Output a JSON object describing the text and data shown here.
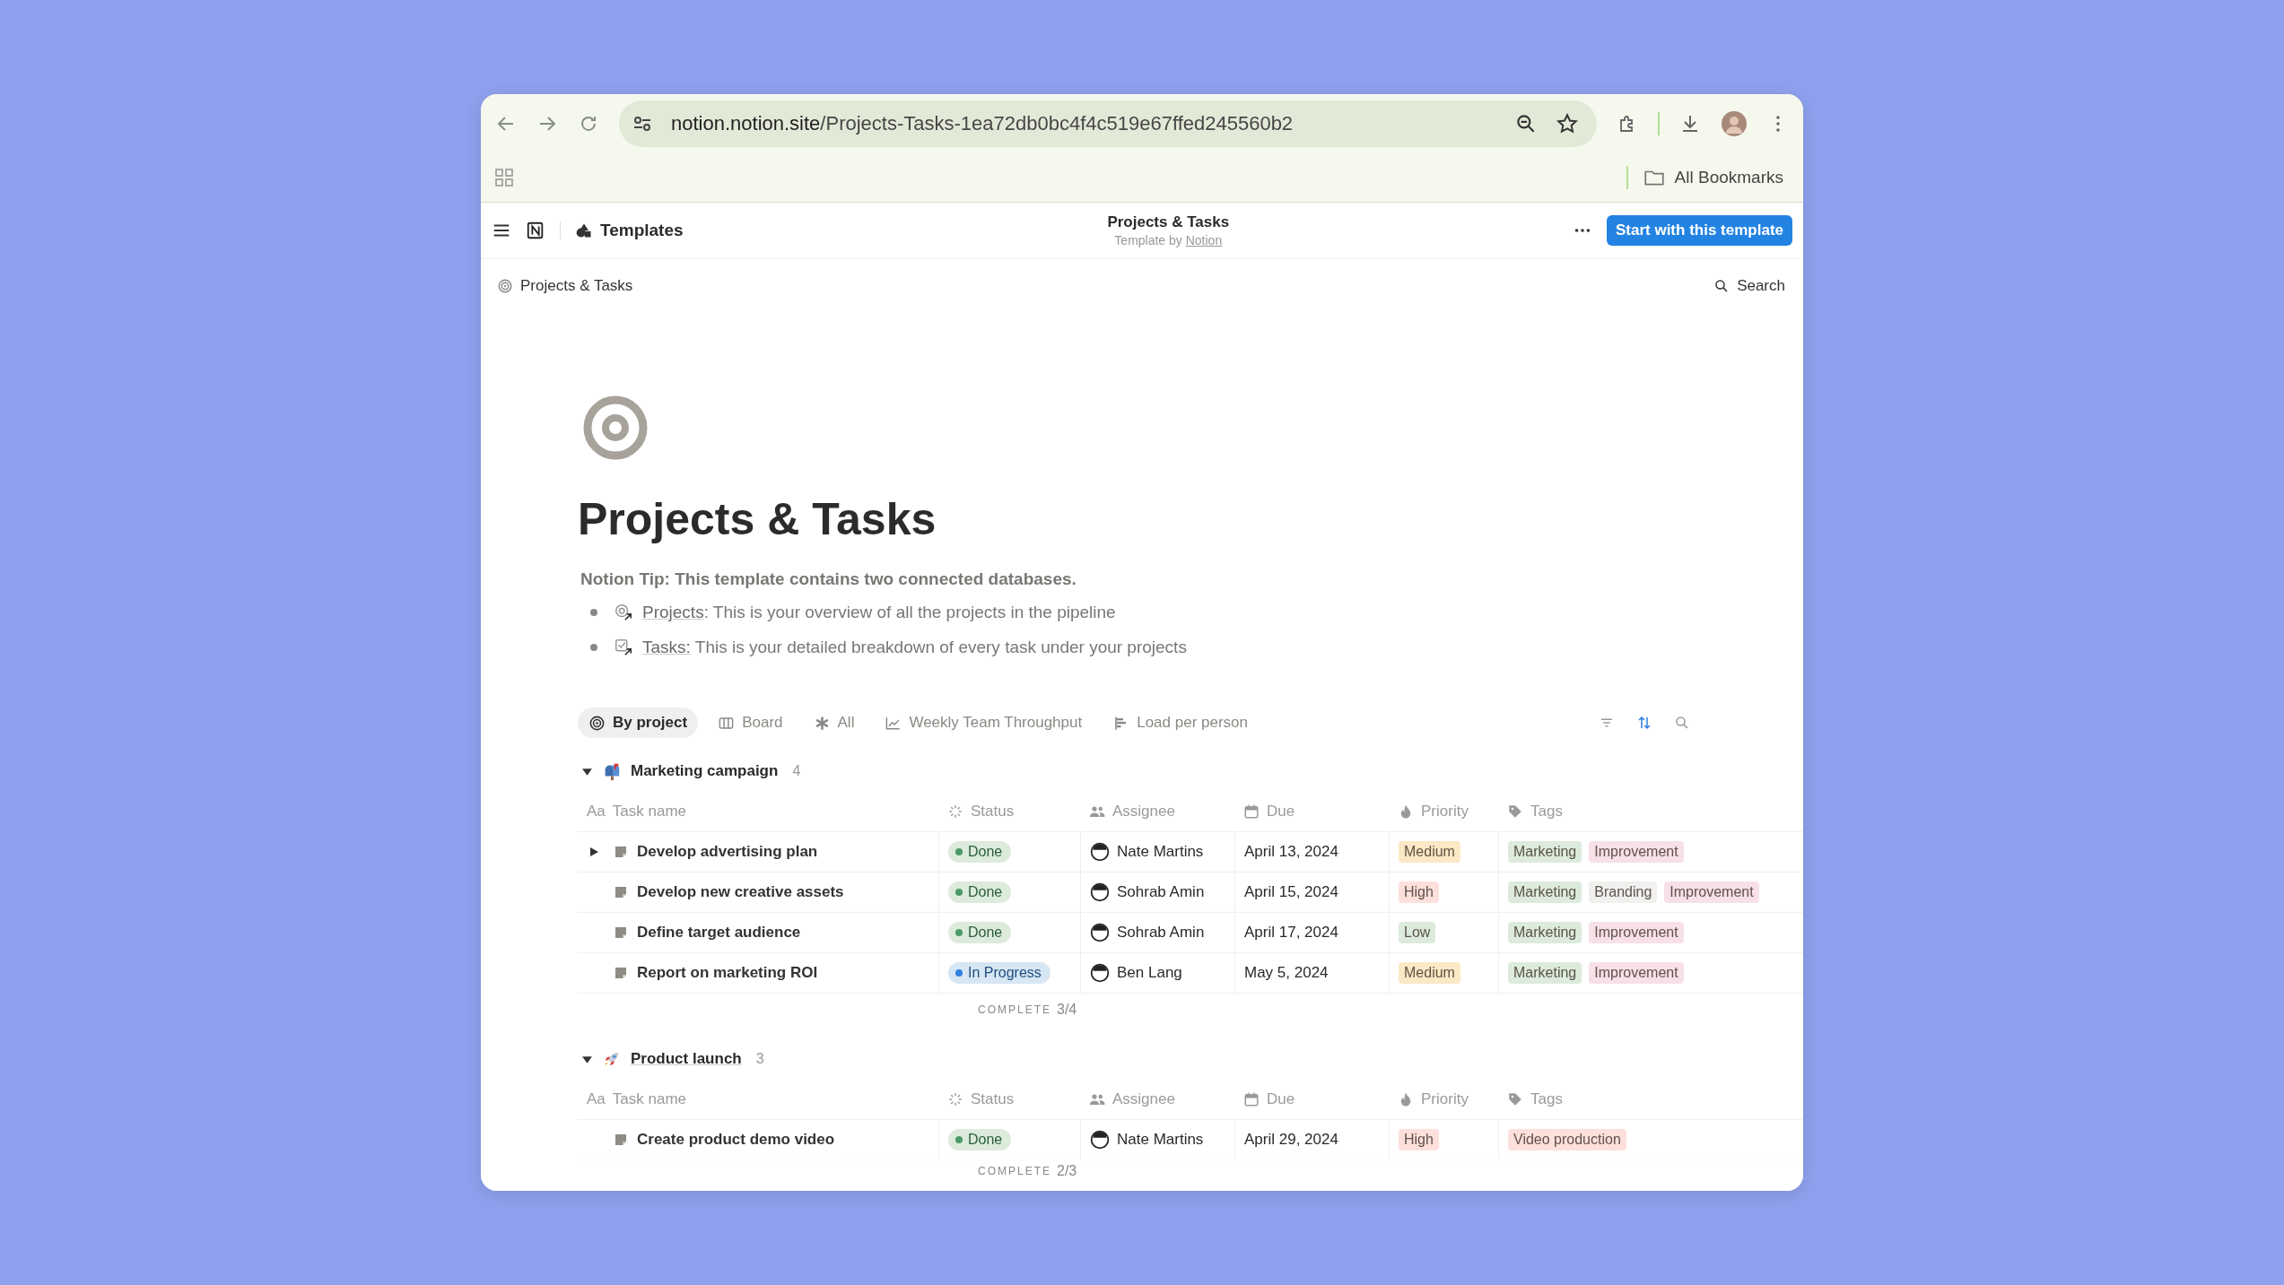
{
  "browser": {
    "url_host": "notion.notion.site",
    "url_path": "/Projects-Tasks-1ea72db0bc4f4c519e67ffed245560b2",
    "bookmarks": "All Bookmarks"
  },
  "topbar": {
    "workspace": "Templates",
    "title": "Projects & Tasks",
    "byline": "Template by",
    "author": "Notion",
    "button": "Start with this template"
  },
  "breadcrumb": "Projects & Tasks",
  "search": "Search",
  "page": {
    "title": "Projects & Tasks",
    "tip": "Notion Tip: This template contains two connected databases.",
    "bullets": [
      {
        "link": "Projects",
        "text": ": This is your overview of all the projects in the pipeline"
      },
      {
        "link": "Tasks:",
        "text": " This is your detailed breakdown of every task under your projects"
      }
    ]
  },
  "views": [
    {
      "label": "By project",
      "selected": true
    },
    {
      "label": "Board",
      "selected": false
    },
    {
      "label": "All",
      "selected": false
    },
    {
      "label": "Weekly Team Throughput",
      "selected": false
    },
    {
      "label": "Load per person",
      "selected": false
    }
  ],
  "groups": [
    {
      "name": "Marketing campaign",
      "count": "4",
      "expanded": true,
      "footer_label": "COMPLETE",
      "footer_value": "3/4",
      "columns": [
        {
          "label": "Task name",
          "glyph": "Aa"
        },
        {
          "label": "Status"
        },
        {
          "label": "Assignee"
        },
        {
          "label": "Due"
        },
        {
          "label": "Priority"
        },
        {
          "label": "Tags"
        }
      ],
      "rows": [
        {
          "name": "Develop advertising plan",
          "expandable": true,
          "status": {
            "label": "Done",
            "kind": "done"
          },
          "assignee": "Nate Martins",
          "due": "April 13, 2024",
          "priority": {
            "label": "Medium",
            "color": "#fbe8c4"
          },
          "tags": [
            {
              "label": "Marketing",
              "color": "#dcebdc"
            },
            {
              "label": "Improvement",
              "color": "#f7e0e8"
            }
          ]
        },
        {
          "name": "Develop new creative assets",
          "expandable": false,
          "status": {
            "label": "Done",
            "kind": "done"
          },
          "assignee": "Sohrab Amin",
          "due": "April 15, 2024",
          "priority": {
            "label": "High",
            "color": "#fde0dc"
          },
          "tags": [
            {
              "label": "Marketing",
              "color": "#dcebdc"
            },
            {
              "label": "Branding",
              "color": "#f0f0ee"
            },
            {
              "label": "Improvement",
              "color": "#f7e0e8"
            }
          ]
        },
        {
          "name": "Define target audience",
          "expandable": false,
          "status": {
            "label": "Done",
            "kind": "done"
          },
          "assignee": "Sohrab Amin",
          "due": "April 17, 2024",
          "priority": {
            "label": "Low",
            "color": "#dcebdc"
          },
          "tags": [
            {
              "label": "Marketing",
              "color": "#dcebdc"
            },
            {
              "label": "Improvement",
              "color": "#f7e0e8"
            }
          ]
        },
        {
          "name": "Report on marketing ROI",
          "expandable": false,
          "status": {
            "label": "In Progress",
            "kind": "in_progress"
          },
          "assignee": "Ben Lang",
          "due": "May 5, 2024",
          "priority": {
            "label": "Medium",
            "color": "#fbe8c4"
          },
          "tags": [
            {
              "label": "Marketing",
              "color": "#dcebdc"
            },
            {
              "label": "Improvement",
              "color": "#f7e0e8"
            }
          ]
        }
      ]
    },
    {
      "name": "Product launch",
      "count": "3",
      "expanded": true,
      "footer_label": "COMPLETE",
      "footer_value": "2/3",
      "columns": [
        {
          "label": "Task name",
          "glyph": "Aa"
        },
        {
          "label": "Status"
        },
        {
          "label": "Assignee"
        },
        {
          "label": "Due"
        },
        {
          "label": "Priority"
        },
        {
          "label": "Tags"
        }
      ],
      "rows": [
        {
          "name": "Create product demo video",
          "expandable": false,
          "status": {
            "label": "Done",
            "kind": "done"
          },
          "assignee": "Nate Martins",
          "due": "April 29, 2024",
          "priority": {
            "label": "High",
            "color": "#fde0dc"
          },
          "tags": [
            {
              "label": "Video production",
              "color": "#fde0dc"
            }
          ]
        }
      ]
    }
  ]
}
